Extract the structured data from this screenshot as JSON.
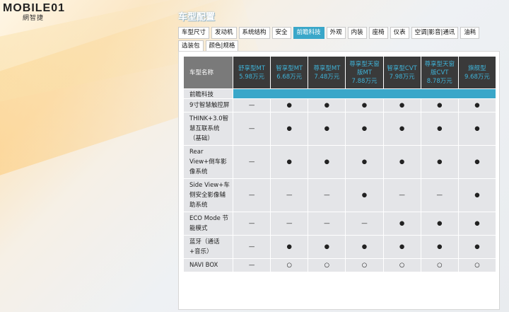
{
  "logo": {
    "text": "MOBILE01",
    "sub": "網智捷"
  },
  "page_title": "车型配置",
  "tabs": [
    {
      "label": "车型尺寸",
      "active": false
    },
    {
      "label": "发动机",
      "active": false
    },
    {
      "label": "系统结构",
      "active": false
    },
    {
      "label": "安全",
      "active": false
    },
    {
      "label": "前瞻科技",
      "active": true
    },
    {
      "label": "外观",
      "active": false
    },
    {
      "label": "内装",
      "active": false
    },
    {
      "label": "座椅",
      "active": false
    },
    {
      "label": "仪表",
      "active": false
    },
    {
      "label": "空调|影音|通讯",
      "active": false
    },
    {
      "label": "油耗",
      "active": false
    },
    {
      "label": "选装包",
      "active": false
    },
    {
      "label": "颜色|规格",
      "active": false
    }
  ],
  "table": {
    "name_header": "车型名称",
    "models": [
      {
        "name": "舒享型MT",
        "price": "5.98万元"
      },
      {
        "name": "智享型MT",
        "price": "6.68万元"
      },
      {
        "name": "尊享型MT",
        "price": "7.48万元"
      },
      {
        "name": "尊享型天窗版MT",
        "price": "7.88万元"
      },
      {
        "name": "智享型CVT",
        "price": "7.98万元"
      },
      {
        "name": "尊享型天窗版CVT",
        "price": "8.78万元"
      },
      {
        "name": "旗舰型",
        "price": "9.68万元"
      }
    ],
    "section": "前瞻科技",
    "rows": [
      {
        "label": "9寸智慧触控屏",
        "values": [
          "—",
          "●",
          "●",
          "●",
          "●",
          "●",
          "●"
        ]
      },
      {
        "label": "THINK+3.0智慧互联系统（基础）",
        "values": [
          "—",
          "●",
          "●",
          "●",
          "●",
          "●",
          "●"
        ]
      },
      {
        "label": "Rear View+倒车影像系统",
        "values": [
          "—",
          "●",
          "●",
          "●",
          "●",
          "●",
          "●"
        ]
      },
      {
        "label": "Side View+车侧安全影像辅助系统",
        "values": [
          "—",
          "—",
          "—",
          "●",
          "—",
          "—",
          "●"
        ]
      },
      {
        "label": "ECO Mode 节能模式",
        "values": [
          "—",
          "—",
          "—",
          "—",
          "●",
          "●",
          "●"
        ]
      },
      {
        "label": "蓝牙（通话+音乐）",
        "values": [
          "—",
          "●",
          "●",
          "●",
          "●",
          "●",
          "●"
        ]
      },
      {
        "label": "NAVI BOX",
        "values": [
          "—",
          "○",
          "○",
          "○",
          "○",
          "○",
          "○"
        ]
      }
    ]
  },
  "colors": {
    "accent": "#3aa7c9",
    "header_bg": "#3a3a3a",
    "row_bg": "#e4e5e8"
  }
}
